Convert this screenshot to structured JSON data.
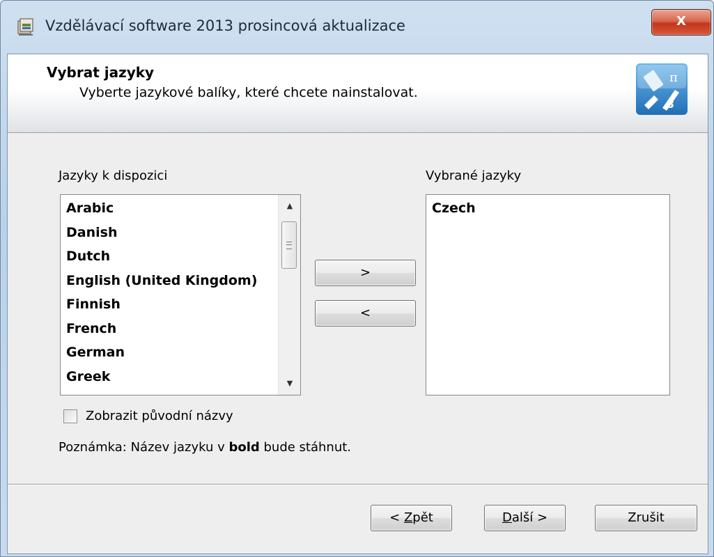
{
  "window": {
    "title": "Vzdělávací software 2013 prosincová aktualizace",
    "close_label": "X"
  },
  "banner": {
    "title": "Vybrat jazyky",
    "subtitle": "Vyberte jazykové balíky, které chcete nainstalovat.",
    "icon": "education-tools-icon"
  },
  "available": {
    "label": "Jazyky k dispozici",
    "items": [
      "Arabic",
      "Danish",
      "Dutch",
      "English (United Kingdom)",
      "Finnish",
      "French",
      "German",
      "Greek"
    ]
  },
  "selected": {
    "label": "Vybrané jazyky",
    "items": [
      "Czech"
    ]
  },
  "move": {
    "add_label": ">",
    "remove_label": "<"
  },
  "options": {
    "show_original_names_label": "Zobrazit původní názvy",
    "show_original_names_checked": false
  },
  "note": {
    "prefix": "Poznámka: Název jazyku v ",
    "bold": "bold",
    "suffix": " bude stáhnut."
  },
  "footer": {
    "back_prefix": "< ",
    "back_accel": "Z",
    "back_rest": "pět",
    "next_accel": "D",
    "next_rest": "alší >",
    "cancel_label": "Zrušit"
  },
  "colors": {
    "close_button": "#c2361c",
    "title_bar": "#b9d1ea",
    "dialog_bg": "#eeeeee"
  }
}
